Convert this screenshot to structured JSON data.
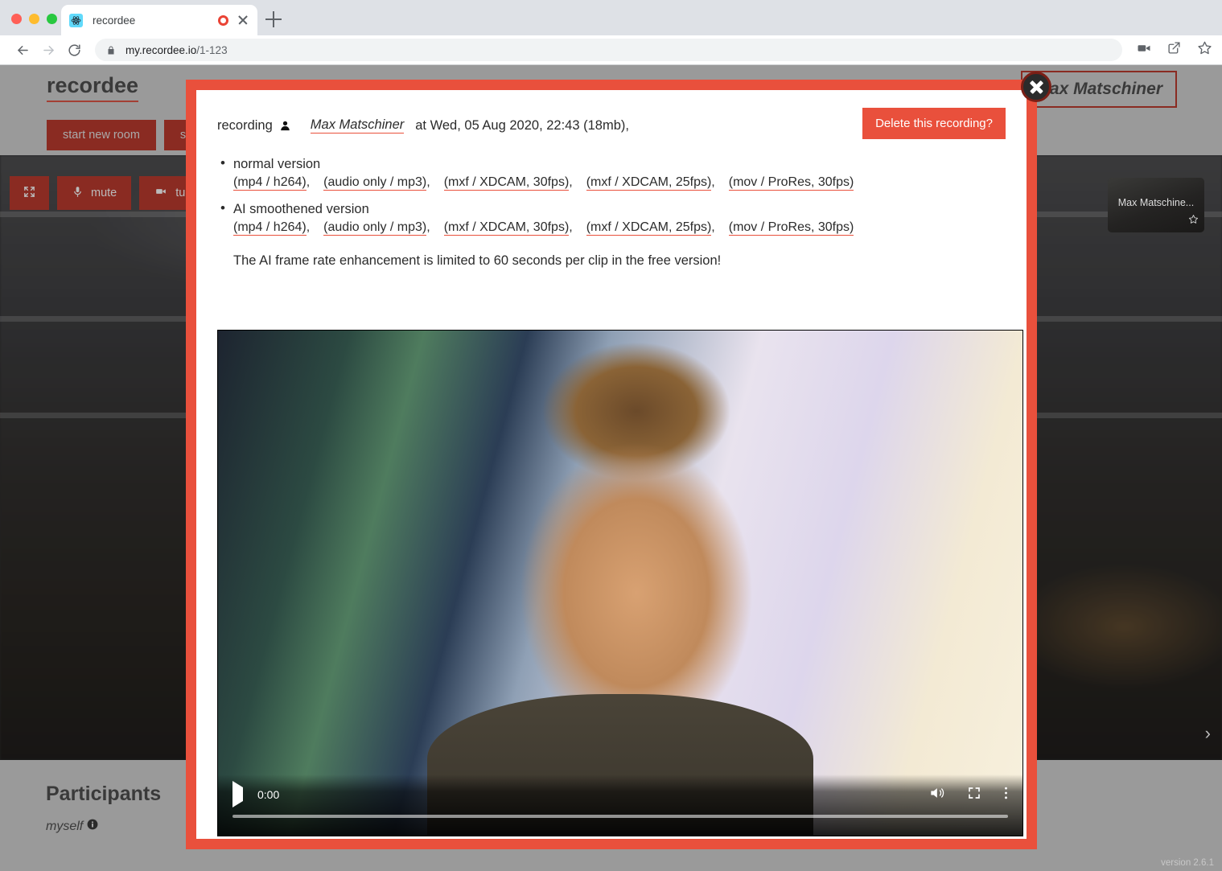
{
  "browser": {
    "tab": {
      "title": "recordee",
      "favicon": "react-icon",
      "recording_indicator": "record-dot-icon",
      "close": "close-icon"
    },
    "new_tab": "+",
    "nav": {
      "back": "back-arrow-icon",
      "forward": "forward-arrow-icon",
      "reload": "reload-icon"
    },
    "omnibox": {
      "lock": "lock-icon",
      "host": "my.recordee.io",
      "path": "/1-123"
    },
    "toolbar_icons": [
      "video-camera-icon",
      "share-icon",
      "bookmark-star-icon"
    ]
  },
  "app": {
    "brand": "recordee",
    "header_buttons": [
      {
        "label": "start new room"
      },
      {
        "label": "sta"
      }
    ],
    "user_chip": "Max Matschiner",
    "stage_controls": [
      {
        "icon": "fullscreen-icon",
        "label": ""
      },
      {
        "icon": "microphone-icon",
        "label": "mute"
      },
      {
        "icon": "camera-icon",
        "label": "turn ca"
      }
    ],
    "thumbnail": {
      "name": "Max Matschine...",
      "star": "star-icon"
    },
    "next_arrow": "›",
    "participants": {
      "title": "Participants",
      "self": "myself",
      "info_icon": "info-icon"
    },
    "version": "version 2.6.1"
  },
  "modal": {
    "close_button": "close-icon",
    "header": {
      "prefix": "recording",
      "person_icon": "person-icon",
      "author": "Max Matschiner",
      "meta": "at Wed, 05 Aug 2020, 22:43 (18mb),",
      "delete_label": "Delete this recording?"
    },
    "sections": [
      {
        "label": "normal version",
        "links": [
          "(mp4 / h264)",
          "(audio only / mp3)",
          "(mxf / XDCAM, 30fps)",
          "(mxf / XDCAM, 25fps)",
          "(mov / ProRes, 30fps)"
        ]
      },
      {
        "label": "AI smoothened version",
        "links": [
          "(mp4 / h264)",
          "(audio only / mp3)",
          "(mxf / XDCAM, 30fps)",
          "(mxf / XDCAM, 25fps)",
          "(mov / ProRes, 30fps)"
        ]
      }
    ],
    "note": "The AI frame rate enhancement is limited to 60 seconds per clip in the free version!",
    "video": {
      "play_icon": "play-icon",
      "time": "0:00",
      "volume_icon": "volume-icon",
      "fullscreen_icon": "fullscreen-icon",
      "menu_icon": "kebab-menu-icon",
      "progress_percent": 0
    }
  },
  "colors": {
    "accent": "#e9503c",
    "page_bg": "#9a9a9a",
    "button_dark_red": "#8a2b22"
  }
}
